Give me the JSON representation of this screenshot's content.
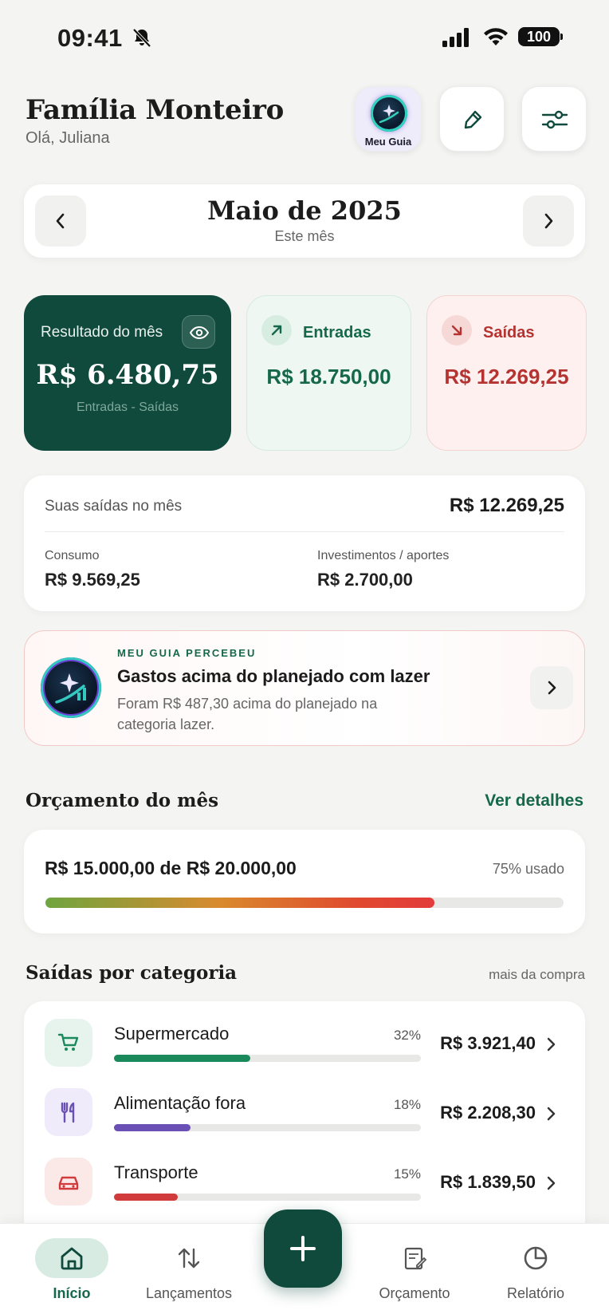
{
  "status_bar": {
    "time": "09:41",
    "battery": "100",
    "icons": [
      "bell-off-icon",
      "signal-icon",
      "wifi-icon",
      "battery-icon"
    ]
  },
  "header": {
    "title": "Família Monteiro",
    "greeting": "Olá, Juliana",
    "guide_label": "Meu Guia",
    "icons": [
      "guide-orb-icon",
      "pen-icon",
      "sliders-icon"
    ]
  },
  "month": {
    "title": "Maio de 2025",
    "subtitle": "Este mês"
  },
  "summary": {
    "result_label": "Resultado do mês",
    "result_value": "R$ 6.480,75",
    "result_sub": "Entradas - Saídas",
    "in_label": "Entradas",
    "in_value": "R$ 18.750,00",
    "out_label": "Saídas",
    "out_value": "R$ 12.269,25"
  },
  "expenses": {
    "title": "Suas saídas no mês",
    "total": "R$ 12.269,25",
    "consumption_label": "Consumo",
    "consumption_value": "R$ 9.569,25",
    "investments_label": "Investimentos / aportes",
    "investments_value": "R$ 2.700,00"
  },
  "insight": {
    "kicker": "MEU GUIA PERCEBEU",
    "title": "Gastos acima do planejado com lazer",
    "body": "Foram R$ 487,30 acima do planejado na categoria lazer."
  },
  "budget": {
    "section_title": "Orçamento do mês",
    "link": "Ver detalhes",
    "amount": "R$ 15.000,00 de R$ 20.000,00",
    "used": "75% usado",
    "fraction": 0.75
  },
  "categories": {
    "section_title": "Saídas por categoria",
    "aside": "mais da compra",
    "items": [
      {
        "name": "Supermercado",
        "pct": "32%",
        "amount": "R$ 3.921,40",
        "fraction": 0.32,
        "icon": "cart-icon",
        "color": "#1a8a5c",
        "bg": "#e7f4ee"
      },
      {
        "name": "Alimentação fora",
        "pct": "18%",
        "amount": "R$ 2.208,30",
        "fraction": 0.18,
        "icon": "fork-knife-icon",
        "color": "#6a4fb5",
        "bg": "#efebfa"
      },
      {
        "name": "Transporte",
        "pct": "15%",
        "amount": "R$ 1.839,50",
        "fraction": 0.15,
        "icon": "car-icon",
        "color": "#d23b3b",
        "bg": "#fbe9e8"
      }
    ]
  },
  "nav": {
    "items": [
      {
        "label": "Início",
        "icon": "home-icon"
      },
      {
        "label": "Lançamentos",
        "icon": "transfer-arrows-icon"
      },
      {
        "label": "Orçamento",
        "icon": "budget-notebook-icon"
      },
      {
        "label": "Relatório",
        "icon": "pie-chart-icon"
      }
    ],
    "fab_icon": "plus-icon"
  },
  "colors": {
    "brand_green": "#0f4a3c",
    "income_green": "#15684c",
    "expense_red": "#b53331",
    "background": "#f4f4f2"
  }
}
